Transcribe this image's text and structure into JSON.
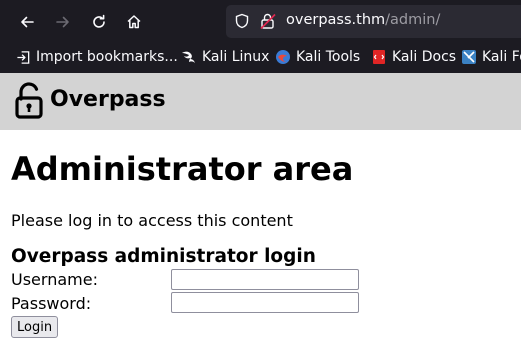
{
  "browser": {
    "url_host": "overpass.thm",
    "url_path": "/admin/",
    "bookmarks": [
      {
        "label": "Import bookmarks...",
        "icon": "import-icon"
      },
      {
        "label": "Kali Linux",
        "icon": "kali-dragon-icon"
      },
      {
        "label": "Kali Tools",
        "icon": "kali-tools-icon"
      },
      {
        "label": "Kali Docs",
        "icon": "kali-docs-icon"
      },
      {
        "label": "Kali Fo",
        "icon": "kali-forums-icon"
      }
    ]
  },
  "site": {
    "brand": "Overpass"
  },
  "page": {
    "heading": "Administrator area",
    "intro": "Please log in to access this content",
    "login_title": "Overpass administrator login",
    "username_label": "Username:",
    "password_label": "Password:",
    "username_value": "",
    "password_value": "",
    "login_button": "Login"
  }
}
